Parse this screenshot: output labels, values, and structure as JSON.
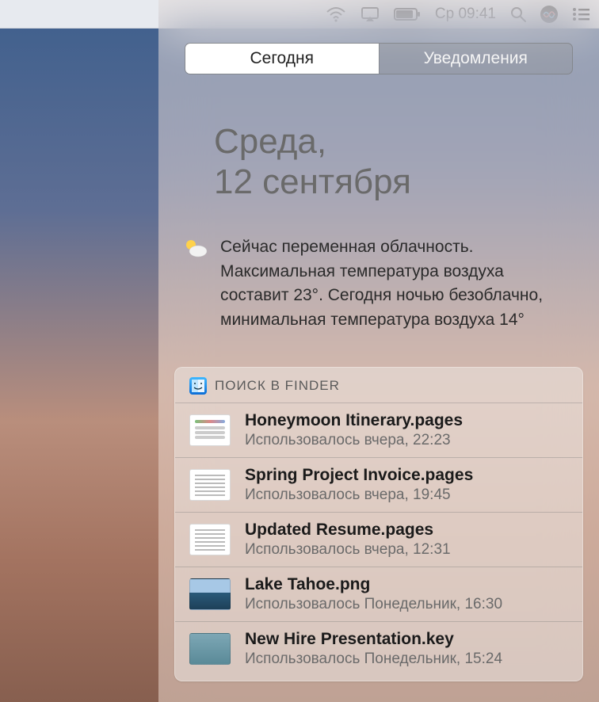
{
  "menubar": {
    "clock": "Ср 09:41"
  },
  "tabs": {
    "today": "Сегодня",
    "notifications": "Уведомления"
  },
  "date": {
    "line1": "Среда,",
    "line2": "12 сентября"
  },
  "weather": {
    "text": "Сейчас переменная облачность. Максимальная температура воздуха составит 23°. Сегодня ночью безоблачно, минимальная температура воздуха 14°"
  },
  "finder": {
    "title": "ПОИСК В FINDER",
    "items": [
      {
        "name": "Honeymoon Itinerary.pages",
        "sub": "Использовалось вчера, 22:23",
        "thumb": "doc"
      },
      {
        "name": "Spring Project Invoice.pages",
        "sub": "Использовалось вчера, 19:45",
        "thumb": "doc2"
      },
      {
        "name": "Updated Resume.pages",
        "sub": "Использовалось вчера, 12:31",
        "thumb": "doc2"
      },
      {
        "name": "Lake Tahoe.png",
        "sub": "Использовалось Понедельник, 16:30",
        "thumb": "img"
      },
      {
        "name": "New Hire Presentation.key",
        "sub": "Использовалось Понедельник, 15:24",
        "thumb": "key"
      }
    ]
  }
}
